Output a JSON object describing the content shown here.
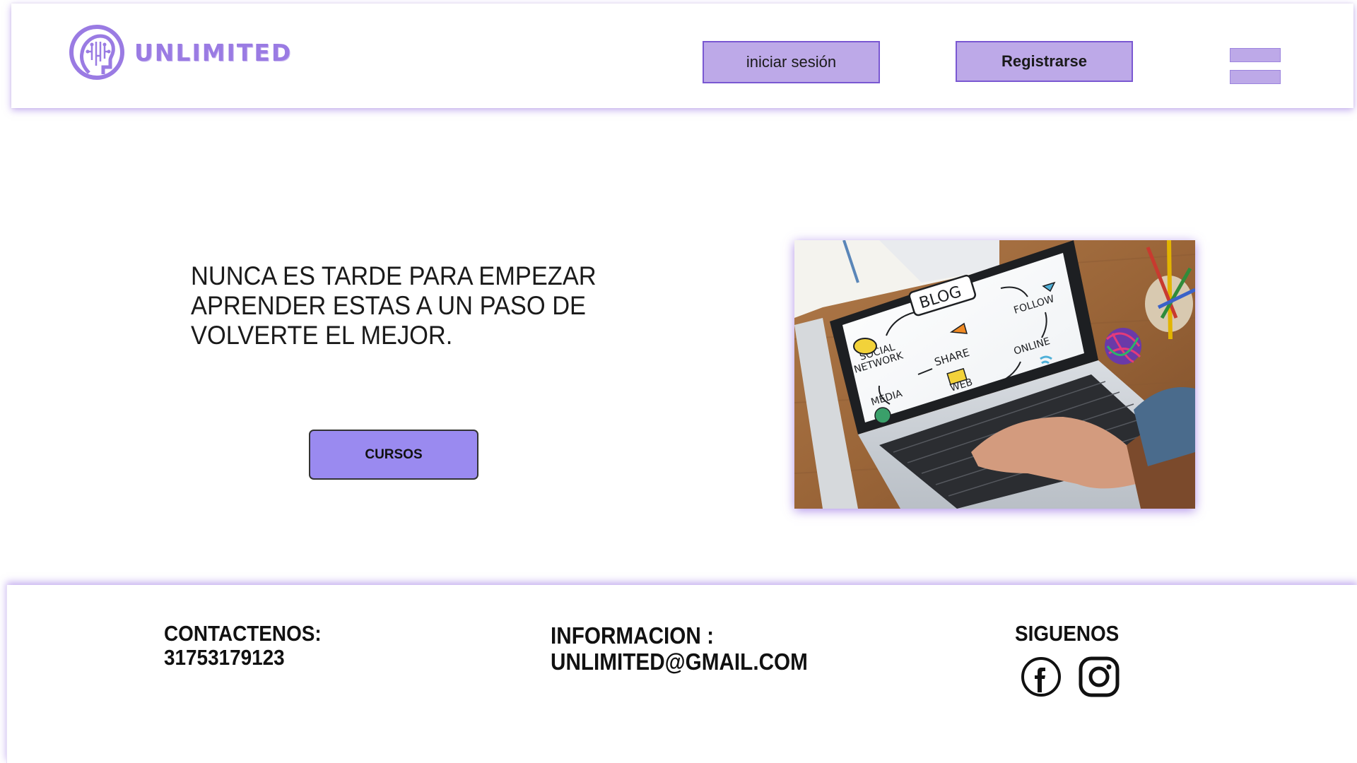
{
  "header": {
    "brand": "UNLIMITED",
    "login_label": "iniciar sesión",
    "register_label": "Registrarse",
    "menu_icon": "hamburger-menu-icon"
  },
  "hero": {
    "line1": "NUNCA ES TARDE PARA EMPEZAR",
    "line2": "APRENDER ESTAS A UN PASO DE",
    "line3": "VOLVERTE EL MEJOR.",
    "courses_label": "CURSOS",
    "image": {
      "labels": {
        "blog": "BLOG",
        "follow": "FOLLOW",
        "social": "SOCIAL",
        "network": "NETWORK",
        "share": "SHARE",
        "online": "ONLINE",
        "media": "MEDIA",
        "web": "WEB"
      }
    }
  },
  "footer": {
    "contact_title": "CONTACTENOS:",
    "contact_phone": "31753179123",
    "info_title": "INFORMACION :",
    "info_email": "UNLIMITED@GMAIL.COM",
    "follow_title": "SIGUENOS",
    "social_icons": [
      "facebook-icon",
      "instagram-icon"
    ]
  },
  "colors": {
    "accent": "#9a7be3",
    "button_fill": "#bda9e8",
    "button_border": "#7a58d2",
    "cta_fill": "#9a8af0",
    "shadow": "#966ee1"
  }
}
